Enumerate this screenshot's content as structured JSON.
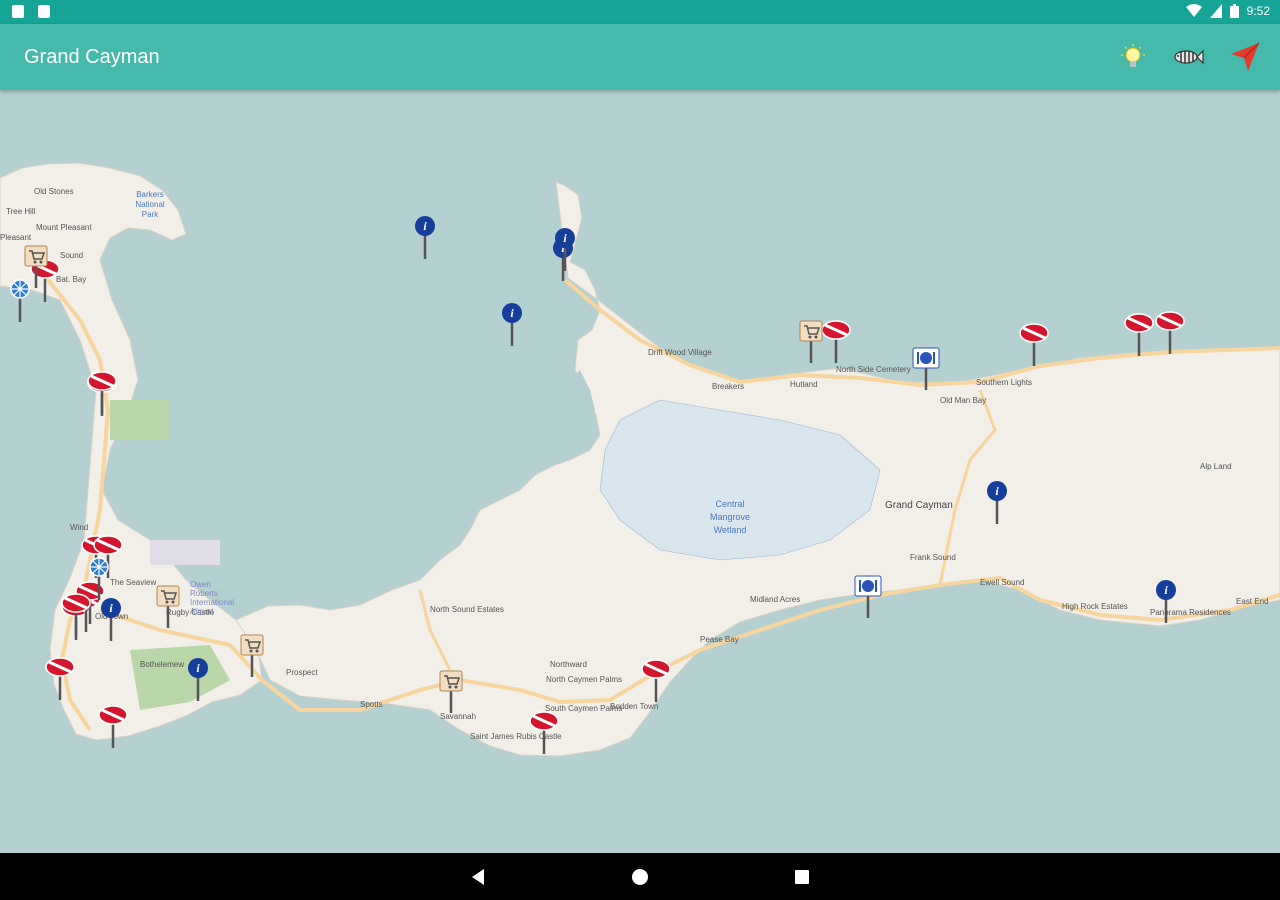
{
  "status_bar": {
    "time": "9:52"
  },
  "app_bar": {
    "title": "Grand Cayman",
    "actions": [
      {
        "name": "lightbulb-icon"
      },
      {
        "name": "fish-icon"
      },
      {
        "name": "navigate-icon"
      }
    ]
  },
  "map": {
    "place_labels": [
      "Old Stones",
      "Tree Hill",
      "Mount Pleasant",
      "Pleasant",
      "Sound",
      "Bat. Bay",
      "Drift Wood Village",
      "Breakers",
      "Hutland",
      "North Side Cemetery",
      "Old Man Bay",
      "Southern Lights",
      "Grand Cayman",
      "Frank Sound",
      "Ewell Sound",
      "Midland Acres",
      "Pease Bay",
      "Northward",
      "North Caymen Palms",
      "Bodden Town",
      "Savannah",
      "South Caymen Palms",
      "Saint James Rubis Castle",
      "North Sound Estates",
      "Spotts",
      "Prospect",
      "Rugby Castle",
      "The Seaview",
      "Owen Roberts International Airport",
      "Wind",
      "Old Town",
      "Bothelemew",
      "High Rock Estates",
      "Panorama Residences",
      "East End",
      "Alp Land"
    ],
    "water_labels": [
      "Central Mangrove Wetland",
      "Barkers National Park"
    ],
    "markers": [
      {
        "type": "dive"
      },
      {
        "type": "dive"
      },
      {
        "type": "dive"
      },
      {
        "type": "dive"
      },
      {
        "type": "dive"
      },
      {
        "type": "dive"
      },
      {
        "type": "dive"
      },
      {
        "type": "dive"
      },
      {
        "type": "dive"
      },
      {
        "type": "dive"
      },
      {
        "type": "dive"
      },
      {
        "type": "dive"
      },
      {
        "type": "dive"
      },
      {
        "type": "dive"
      },
      {
        "type": "dive"
      },
      {
        "type": "dive"
      },
      {
        "type": "dive"
      },
      {
        "type": "info"
      },
      {
        "type": "info"
      },
      {
        "type": "info"
      },
      {
        "type": "info"
      },
      {
        "type": "info"
      },
      {
        "type": "info"
      },
      {
        "type": "info"
      },
      {
        "type": "info"
      },
      {
        "type": "shop"
      },
      {
        "type": "shop"
      },
      {
        "type": "shop"
      },
      {
        "type": "shop"
      },
      {
        "type": "shop"
      },
      {
        "type": "restaurant"
      },
      {
        "type": "restaurant"
      },
      {
        "type": "marina"
      },
      {
        "type": "marina"
      }
    ]
  },
  "nav_bar": {
    "buttons": [
      "back",
      "home",
      "recents"
    ]
  },
  "colors": {
    "status_bar": "#16a497",
    "app_bar": "#45b9ab",
    "water": "#b5d0d0",
    "land": "#f2efe9",
    "road": "#f7d59c",
    "dive_flag": "#d3162e",
    "info_pin": "#163f9c"
  }
}
